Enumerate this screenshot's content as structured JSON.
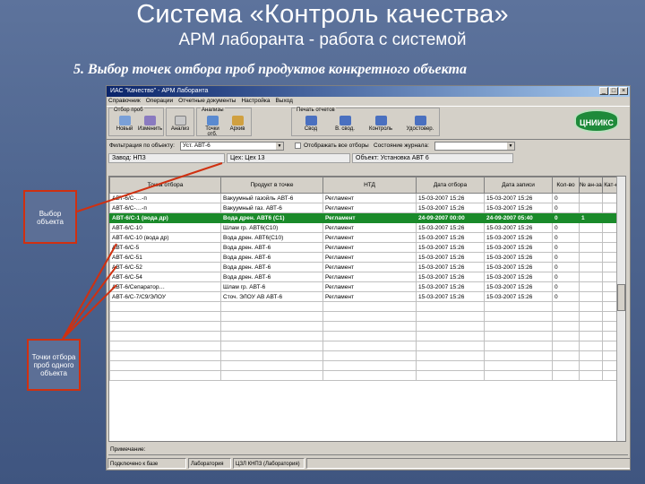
{
  "slide": {
    "title": "Система «Контроль качества»",
    "subtitle": "АРМ лаборанта - работа с системой",
    "heading": "5. Выбор точек отбора проб продуктов конкретного объекта"
  },
  "window": {
    "title": "ИАС \"Качество\" - АРМ Лаборанта",
    "menu": [
      "Справочник",
      "Операции",
      "Отчетные документы",
      "Настройка",
      "Выход"
    ],
    "toolbar_groups": [
      {
        "label": "Отбор проб",
        "buttons": [
          "Новый",
          "Изменить"
        ]
      },
      {
        "label": "",
        "buttons": [
          "Анализ"
        ]
      },
      {
        "label": "Анализы",
        "buttons": [
          "Точки отб.",
          "Архив"
        ]
      },
      {
        "label": "Печать отчетов",
        "buttons": [
          "Свод",
          "В. свод.",
          "Контроль",
          "Удостовер."
        ]
      }
    ],
    "logo_text": "ЦНИИКС",
    "filter": {
      "label": "Фильтрация по объекту:",
      "value": "Уст. АВТ-6",
      "checkbox_label": "Отображать все отборы",
      "journal_label": "Состояние журнала:",
      "journal_value": ""
    },
    "info": {
      "plant": "Завод: НПЗ",
      "shop": "Цех: Цех 13",
      "object": "Объект: Установка АВТ 6"
    },
    "columns": [
      "Точка отбора",
      "Продукт в точке",
      "НТД",
      "Дата отбора",
      "Дата записи",
      "Кол-во",
      "№ ан-за",
      "Кат-е"
    ],
    "rows": [
      [
        "АВТ-6/С-…-п",
        "Вакуумный газойль АВТ-6",
        "Регламент",
        "15-03-2007 15:26",
        "15-03-2007 15:26",
        "0",
        "",
        ""
      ],
      [
        "АВТ-6/С-…-п",
        "Вакуумный газ. АВТ-6",
        "Регламент",
        "15-03-2007 15:26",
        "15-03-2007 15:26",
        "0",
        "",
        ""
      ],
      [
        "АВТ-6/С-1 (вода др)",
        "Вода дрен. АВТ6 (С1)",
        "Регламент",
        "24-09-2007 00:00",
        "24-09-2007 05:40",
        "0",
        "1",
        ""
      ],
      [
        "АВТ-6/С-10",
        "Шлам гр. АВТ6(С10)",
        "Регламент",
        "15-03-2007 15:26",
        "15-03-2007 15:26",
        "0",
        "",
        ""
      ],
      [
        "АВТ-6/С-10 (вода др)",
        "Вода дрен. АВТ6(С10)",
        "Регламент",
        "15-03-2007 15:26",
        "15-03-2007 15:26",
        "0",
        "",
        ""
      ],
      [
        "АВТ-6/С-5",
        "Вода дрен. АВТ-6",
        "Регламент",
        "15-03-2007 15:26",
        "15-03-2007 15:26",
        "0",
        "",
        ""
      ],
      [
        "АВТ-6/С-51",
        "Вода дрен. АВТ-6",
        "Регламент",
        "15-03-2007 15:26",
        "15-03-2007 15:26",
        "0",
        "",
        ""
      ],
      [
        "АВТ-6/С-52",
        "Вода дрен. АВТ-6",
        "Регламент",
        "15-03-2007 15:26",
        "15-03-2007 15:26",
        "0",
        "",
        ""
      ],
      [
        "АВТ-6/С-54",
        "Вода дрен. АВТ-6",
        "Регламент",
        "15-03-2007 15:26",
        "15-03-2007 15:26",
        "0",
        "",
        ""
      ],
      [
        "АВТ-6/Сепаратор…",
        "Шлам гр. АВТ-6",
        "Регламент",
        "15-03-2007 15:26",
        "15-03-2007 15:26",
        "0",
        "",
        ""
      ],
      [
        "АВТ-6/С-7/С9/ЭЛОУ",
        "Сточ. ЭЛОУ АВ АВТ-6",
        "Регламент",
        "15-03-2007 15:26",
        "15-03-2007 15:26",
        "0",
        "",
        ""
      ]
    ],
    "notes_label": "Примечание:",
    "status": [
      "Подключено к базе",
      "Лаборатория",
      "ЦЗЛ КНПЗ (Лаборатория)"
    ]
  },
  "callouts": {
    "object_select": "Выбор объекта",
    "sample_points": "Точки отбора проб одного объекта"
  },
  "colors": {
    "slide_bg": "#4f6690",
    "selected_row": "#1a8a2a",
    "callout_border": "#d03010"
  }
}
